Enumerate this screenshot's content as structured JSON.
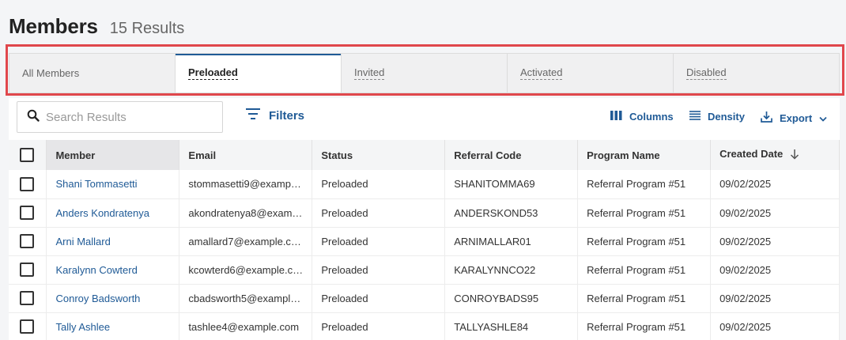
{
  "header": {
    "title": "Members",
    "count": "15 Results"
  },
  "tabs": [
    {
      "label": "All Members"
    },
    {
      "label": "Preloaded"
    },
    {
      "label": "Invited"
    },
    {
      "label": "Activated"
    },
    {
      "label": "Disabled"
    }
  ],
  "toolbar": {
    "search_placeholder": "Search Results",
    "filters_label": "Filters",
    "columns_label": "Columns",
    "density_label": "Density",
    "export_label": "Export"
  },
  "table": {
    "headers": [
      "Member",
      "Email",
      "Status",
      "Referral Code",
      "Program Name",
      "Created Date"
    ],
    "rows": [
      [
        "Shani Tommasetti",
        "stommasetti9@examp…",
        "Preloaded",
        "SHANITOMMA69",
        "Referral Program #51",
        "09/02/2025"
      ],
      [
        "Anders Kondratenya",
        "akondratenya8@exam…",
        "Preloaded",
        "ANDERSKOND53",
        "Referral Program #51",
        "09/02/2025"
      ],
      [
        "Arni Mallard",
        "amallard7@example.c…",
        "Preloaded",
        "ARNIMALLAR01",
        "Referral Program #51",
        "09/02/2025"
      ],
      [
        "Karalynn Cowterd",
        "kcowterd6@example.c…",
        "Preloaded",
        "KARALYNNCO22",
        "Referral Program #51",
        "09/02/2025"
      ],
      [
        "Conroy Badsworth",
        "cbadsworth5@exampl…",
        "Preloaded",
        "CONROYBADS95",
        "Referral Program #51",
        "09/02/2025"
      ],
      [
        "Tally Ashlee",
        "tashlee4@example.com",
        "Preloaded",
        "TALLYASHLE84",
        "Referral Program #51",
        "09/02/2025"
      ]
    ]
  },
  "colors": {
    "accent": "#1f5a96",
    "highlight": "#e0474c"
  }
}
